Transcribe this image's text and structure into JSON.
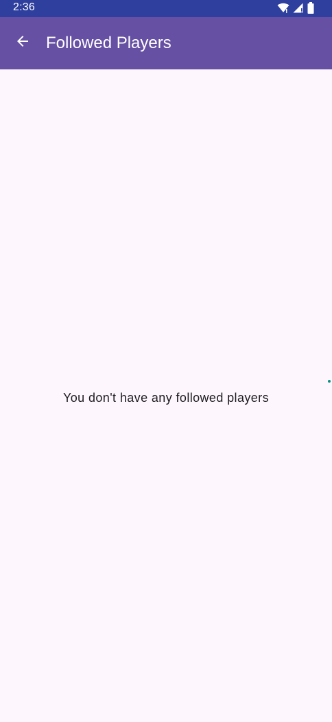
{
  "status_bar": {
    "time": "2:36",
    "icons": [
      "wifi-icon",
      "signal-icon",
      "battery-icon"
    ]
  },
  "app_bar": {
    "title": "Followed Players",
    "back_icon": "arrow-back-icon"
  },
  "content": {
    "empty_message": "You don't have any followed players"
  },
  "colors": {
    "status_bar": "#2f3f9e",
    "app_bar": "#6650a4",
    "background": "#fdf7fd",
    "text": "#1d1b20",
    "accent_dot": "#0b8f83"
  }
}
